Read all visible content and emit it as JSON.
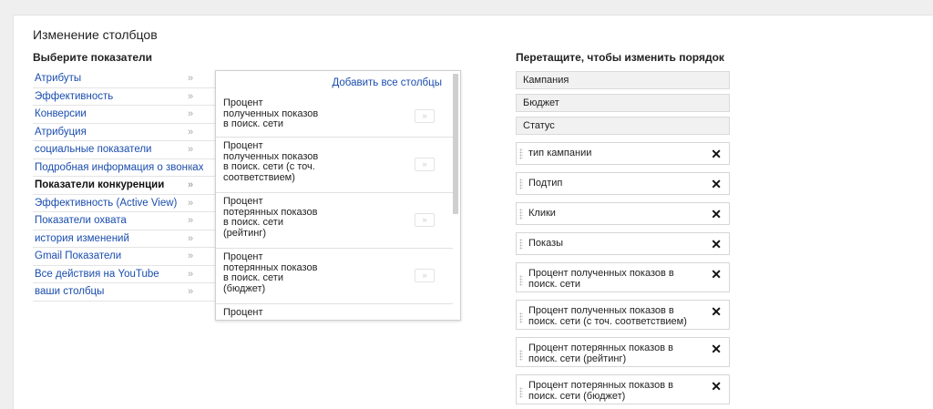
{
  "page": {
    "title": "Изменение столбцов",
    "left_heading": "Выберите показатели",
    "right_heading": "Перетащите, чтобы изменить порядок"
  },
  "categories": [
    {
      "label": "Атрибуты",
      "active": false
    },
    {
      "label": "Эффективность",
      "active": false
    },
    {
      "label": "Конверсии",
      "active": false
    },
    {
      "label": "Атрибуция",
      "active": false
    },
    {
      "label": "социальные показатели",
      "active": false
    },
    {
      "label": "Подробная информация о звонках",
      "active": false
    },
    {
      "label": "Показатели конкуренции",
      "active": true
    },
    {
      "label": "Эффективность (Active View)",
      "active": false
    },
    {
      "label": "Показатели охвата",
      "active": false
    },
    {
      "label": "история изменений",
      "active": false
    },
    {
      "label": "Gmail Показатели",
      "active": false
    },
    {
      "label": "Все действия на YouTube",
      "active": false
    },
    {
      "label": "ваши столбцы",
      "active": false
    }
  ],
  "category_arrow": "»",
  "metrics": {
    "add_all_label": "Добавить все столбцы",
    "add_button_label": "»",
    "items": [
      {
        "label": "Процент\nполученных показов\nв поиск. сети"
      },
      {
        "label": "Процент\nполученных показов\nв поиск. сети (с точ.\nсоответствием)"
      },
      {
        "label": "Процент\nпотерянных показов\nв поиск. сети\n(рейтинг)"
      },
      {
        "label": "Процент\nпотерянных показов\nв поиск. сети\n(бюджет)"
      },
      {
        "label": "Процент"
      }
    ]
  },
  "columns": {
    "fixed": [
      "Кампания",
      "Бюджет",
      "Статус"
    ],
    "removable": [
      {
        "label": "тип кампании"
      },
      {
        "label": "Подтип"
      },
      {
        "label": "Клики"
      },
      {
        "label": "Показы"
      },
      {
        "label": "Процент полученных показов в поиск. сети"
      },
      {
        "label": "Процент полученных показов в поиск. сети (с точ. соответствием)"
      },
      {
        "label": "Процент потерянных показов в поиск. сети (рейтинг)"
      },
      {
        "label": "Процент потерянных показов в поиск. сети (бюджет)"
      }
    ],
    "remove_symbol": "✕"
  },
  "colors": {
    "link": "#1a4dae",
    "background": "#efefef",
    "panel": "#ffffff"
  }
}
